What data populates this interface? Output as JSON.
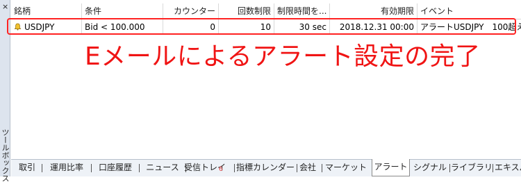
{
  "side_panel": {
    "close_glyph": "×",
    "title": "ツールボックス"
  },
  "columns": [
    "銘柄",
    "条件",
    "カウンター",
    "回数制限",
    "制限時間を...",
    "有効期限",
    "イベント"
  ],
  "row": {
    "symbol": "USDJPY",
    "condition": "Bid < 100.000",
    "counter": "0",
    "limit": "10",
    "timeout": "30 sec",
    "expiry": "2018.12.31 00:00",
    "event": "アラートUSDJPY　100超え"
  },
  "annotation": "Eメールによるアラート設定の完了",
  "highlight_color": "#ff2222",
  "tabs": [
    {
      "label": "取引"
    },
    {
      "label": "運用比率"
    },
    {
      "label": "口座履歴"
    },
    {
      "label": "ニュース"
    },
    {
      "label": "受信トレイ",
      "badge": "6"
    },
    {
      "label": "指標カレンダー"
    },
    {
      "label": "会社"
    },
    {
      "label": "マーケット"
    },
    {
      "label": "アラート",
      "active": true
    },
    {
      "label": "シグナル"
    },
    {
      "label": "ライブラリ"
    },
    {
      "label": "エキスパー"
    }
  ]
}
